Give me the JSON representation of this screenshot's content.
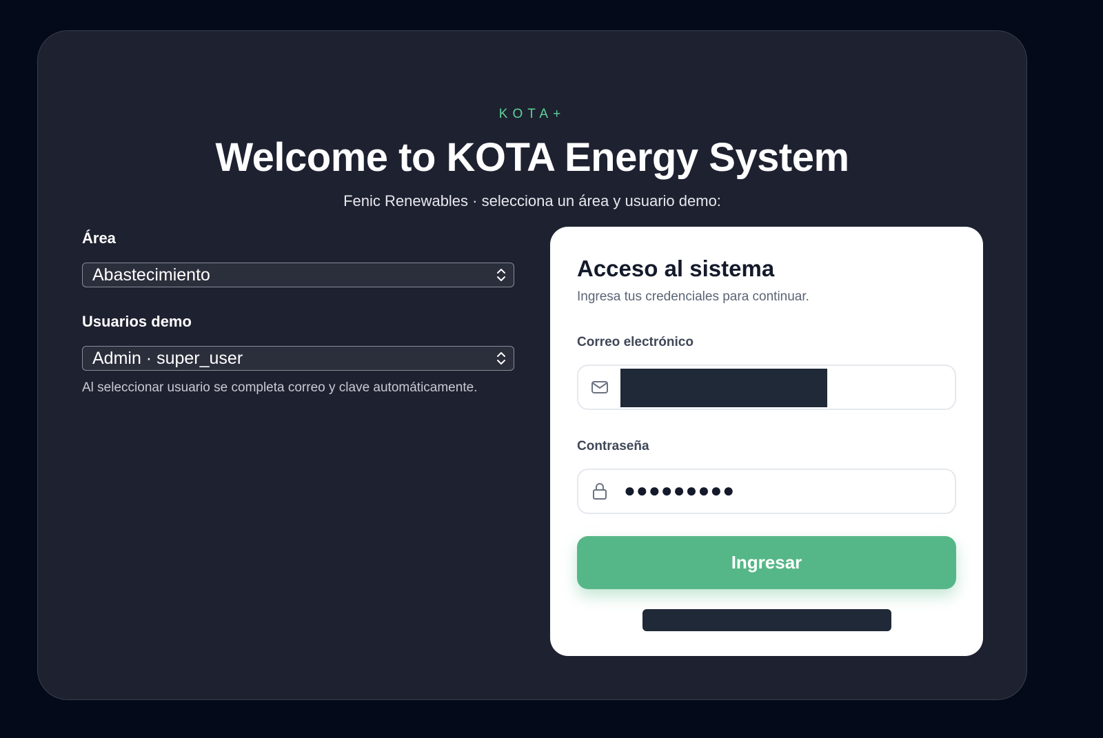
{
  "brand": "KOTA+",
  "title": "Welcome to KOTA Energy System",
  "subtitle": "Fenic Renewables · selecciona un área y usuario demo:",
  "left": {
    "area_label": "Área",
    "area_value": "Abastecimiento",
    "users_label": "Usuarios demo",
    "users_value": "Admin · super_user",
    "help_text": "Al seleccionar usuario se completa correo y clave automáticamente."
  },
  "login": {
    "title": "Acceso al sistema",
    "subtitle": "Ingresa tus credenciales para continuar.",
    "email_label": "Correo electrónico",
    "email_icon": "mail-icon",
    "password_label": "Contraseña",
    "password_icon": "lock-icon",
    "password_mask": "●●●●●●●●●",
    "submit_label": "Ingresar"
  },
  "colors": {
    "accent": "#55b787",
    "brand": "#5fd39a",
    "panel": "#1e2130",
    "background": "#050a1a"
  }
}
